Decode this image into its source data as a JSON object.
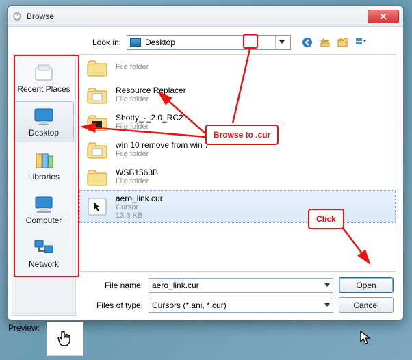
{
  "window": {
    "title": "Browse"
  },
  "lookin": {
    "label": "Look in:",
    "value": "Desktop"
  },
  "sidebar": {
    "items": [
      {
        "label": "Recent Places"
      },
      {
        "label": "Desktop"
      },
      {
        "label": "Libraries"
      },
      {
        "label": "Computer"
      },
      {
        "label": "Network"
      }
    ],
    "selected_index": 1
  },
  "files": {
    "items": [
      {
        "name": "",
        "sub1": "File folder",
        "sub2": "",
        "type": "folder-partial"
      },
      {
        "name": "Resource Replacer",
        "sub1": "File folder",
        "sub2": "",
        "type": "folder"
      },
      {
        "name": "Shotty_-_2.0_RC2",
        "sub1": "File folder",
        "sub2": "",
        "type": "folder"
      },
      {
        "name": "win 10 remove from win 7",
        "sub1": "File folder",
        "sub2": "",
        "type": "folder"
      },
      {
        "name": "WSB1563B",
        "sub1": "File folder",
        "sub2": "",
        "type": "folder"
      },
      {
        "name": "aero_link.cur",
        "sub1": "Cursor",
        "sub2": "13.6 KB",
        "type": "cursor"
      }
    ],
    "selected_index": 5
  },
  "form": {
    "file_name_label": "File name:",
    "file_name_value": "aero_link.cur",
    "filter_label": "Files of type:",
    "filter_value": "Cursors (*.ani, *.cur)",
    "open_label": "Open",
    "cancel_label": "Cancel"
  },
  "preview": {
    "label": "Preview:"
  },
  "annotations": {
    "browse_text": "Browse to .cur",
    "click_text": "Click"
  },
  "colors": {
    "accent_red": "#e11",
    "select_bg": "#d7e8f7"
  }
}
